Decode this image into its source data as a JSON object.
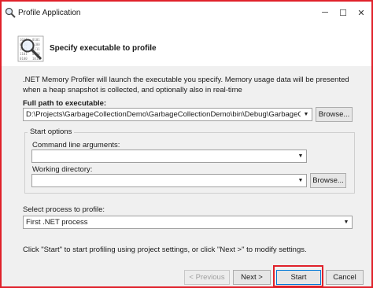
{
  "window": {
    "title": "Profile Application",
    "controls": {
      "minimize": "─",
      "maximize": "☐",
      "close": "✕"
    },
    "accent_color": "#e0212a"
  },
  "header": {
    "title": "Specify executable to profile",
    "icon": "magnifier-binary-icon"
  },
  "description": ".NET Memory Profiler will launch the executable you specify. Memory usage data will be presented when a heap snapshot is collected, and optionally also in real-time",
  "executable": {
    "label": "Full path to executable:",
    "value": "D:\\Projects\\GarbageCollectionDemo\\GarbageCollectionDemo\\bin\\Debug\\GarbageCollectionD",
    "browse_label": "Browse..."
  },
  "start_options": {
    "title": "Start options",
    "command_line_label": "Command line arguments:",
    "command_line_value": "",
    "working_dir_label": "Working directory:",
    "working_dir_value": "",
    "browse_label": "Browse..."
  },
  "process": {
    "label": "Select process to profile:",
    "value": "First .NET process"
  },
  "footer_text": "Click \"Start\" to start profiling using project settings, or click \"Next >\" to modify settings.",
  "buttons": {
    "previous": "< Previous",
    "next": "Next >",
    "start": "Start",
    "cancel": "Cancel"
  }
}
